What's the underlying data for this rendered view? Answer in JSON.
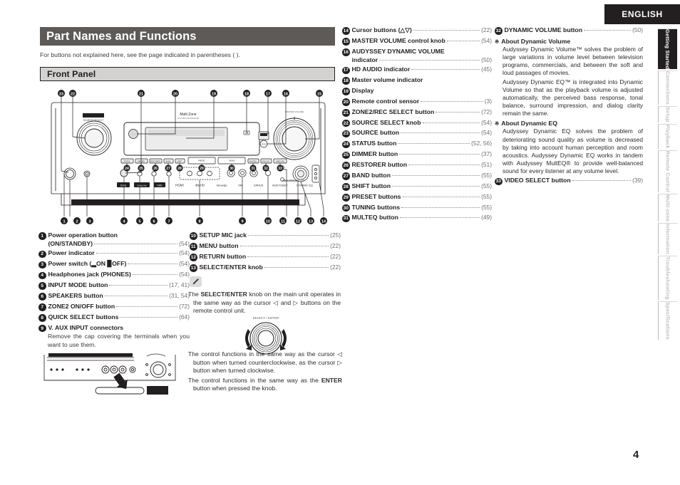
{
  "header": {
    "language_badge": "ENGLISH",
    "page_number": "4"
  },
  "title": "Part Names and Functions",
  "subtitle": "For buttons not explained here, see the page indicated in parentheses (  ).",
  "section": "Front Panel",
  "side_tabs": [
    {
      "label": "Getting Started",
      "active": true
    },
    {
      "label": "Connections",
      "active": false
    },
    {
      "label": "Setup",
      "active": false
    },
    {
      "label": "Playback",
      "active": false
    },
    {
      "label": "Remote Control",
      "active": false
    },
    {
      "label": "Multi-zone",
      "active": false
    },
    {
      "label": "Information",
      "active": false
    },
    {
      "label": "Troubleshooting",
      "active": false
    },
    {
      "label": "Specifications",
      "active": false
    }
  ],
  "column_a": [
    {
      "num": "1",
      "label": "Power operation button",
      "label2": "(ON/STANDBY)",
      "page": "(54)"
    },
    {
      "num": "2",
      "label": "Power indicator",
      "page": "(54)"
    },
    {
      "num": "3",
      "label": "Power switch (▂ON ▉OFF)",
      "page": "(54)"
    },
    {
      "num": "4",
      "label": "Headphones jack (PHONES)",
      "page": "(54)"
    },
    {
      "num": "5",
      "label": "INPUT MODE button",
      "page": "(17, 41)"
    },
    {
      "num": "6",
      "label": "SPEAKERS button",
      "page": "(31, 54)"
    },
    {
      "num": "7",
      "label": "ZONE2 ON/OFF button",
      "page": "(72)"
    },
    {
      "num": "8",
      "label": "QUICK SELECT buttons",
      "page": "(64)"
    },
    {
      "num": "9",
      "label": "V. AUX INPUT connectors",
      "note": "Remove the cap covering the terminals when you want to use them."
    }
  ],
  "column_b": [
    {
      "num": "10",
      "label": "SETUP MIC jack",
      "page": "(25)"
    },
    {
      "num": "11",
      "label": "MENU button",
      "page": "(22)"
    },
    {
      "num": "12",
      "label": "RETURN button",
      "page": "(22)"
    },
    {
      "num": "13",
      "label": "SELECT/ENTER knob",
      "page": "(22)"
    }
  ],
  "note_block": {
    "icon": "pencil-icon",
    "text_before": "The ",
    "bold": "SELECT/ENTER",
    "text_after": " knob on the main unit operates in the same way as the cursor ◁ and ▷ buttons on the remote control unit.",
    "knob_caption": "SELECT / ENTER"
  },
  "bullets2": [
    {
      "text": "The control functions in the same way as the cursor ◁ button when turned counterclockwise, as the cursor ▷ button when turned clockwise."
    },
    {
      "pre": "The control functions in the same way as the ",
      "bold": "ENTER",
      "post": " button when pressed the knob."
    }
  ],
  "column_c": [
    {
      "num": "14",
      "label": "Cursor buttons (△▽)",
      "page": "(22)"
    },
    {
      "num": "15",
      "label": "MASTER VOLUME control knob",
      "page": "(54)"
    },
    {
      "num": "16",
      "label": "AUDYSSEY DYNAMIC VOLUME",
      "label2": "indicator",
      "page": "(50)"
    },
    {
      "num": "17",
      "label": "HD AUDIO indicator",
      "page": "(45)"
    },
    {
      "num": "18",
      "label": "Master volume indicator",
      "page": ""
    },
    {
      "num": "19",
      "label": "Display",
      "page": ""
    },
    {
      "num": "20",
      "label": "Remote control sensor",
      "page": "(3)"
    },
    {
      "num": "21",
      "label": "ZONE2/REC SELECT button",
      "page": "(72)"
    },
    {
      "num": "22",
      "label": "SOURCE SELECT knob",
      "page": "(54)"
    },
    {
      "num": "23",
      "label": "SOURCE button",
      "page": "(54)"
    },
    {
      "num": "24",
      "label": "STATUS button",
      "page": "(52, 56)"
    },
    {
      "num": "25",
      "label": "DIMMER button",
      "page": "(37)"
    },
    {
      "num": "26",
      "label": "RESTORER button",
      "page": "(51)"
    },
    {
      "num": "27",
      "label": "BAND button",
      "page": "(55)"
    },
    {
      "num": "28",
      "label": "SHIFT button",
      "page": "(55)"
    },
    {
      "num": "29",
      "label": "PRESET buttons",
      "page": "(55)"
    },
    {
      "num": "30",
      "label": "TUNING buttons",
      "page": "(55)"
    },
    {
      "num": "31",
      "label": "MULTEQ button",
      "page": "(49)"
    }
  ],
  "column_d": {
    "item32": {
      "num": "32",
      "label": "DYNAMIC VOLUME button",
      "page": "(50)"
    },
    "dyn_volume_head": "About Dynamic Volume",
    "dyn_volume_p1": "Audyssey Dynamic Volume™ solves the problem of large variations in volume level between television programs, commercials, and between the soft and loud passages of movies.",
    "dyn_volume_p2": "Audyssey Dynamic EQ™ is integrated into Dynamic Volume so that as the playback volume is adjusted automatically, the perceived bass response, tonal balance, surround impression, and dialog clarity remain the same.",
    "dyn_eq_head": "About Dynamic EQ",
    "dyn_eq_p1": "Audyssey Dynamic EQ solves the problem of deteriorating sound quality as volume is decreased by taking into account human perception and room acoustics. Audyssey Dynamic EQ works in tandem with Audyssey MultEQ® to provide well-balanced sound for every listener at any volume level.",
    "item33": {
      "num": "33",
      "label": "VIDEO SELECT button",
      "page": "(39)"
    },
    "section_mark": "※"
  },
  "diagram": {
    "brand": "DENON",
    "source_select_label": "SOURCE SELECT",
    "multi_zone_label": "Multi Zone",
    "master_volume_label": "MASTER VOLUME",
    "top_callouts": [
      "23",
      "22",
      "21",
      "20",
      "19",
      "18",
      "17",
      "16",
      "15"
    ],
    "mid_callouts": [
      "24",
      "25",
      "26",
      "27",
      "28",
      "29",
      "30",
      "31",
      "32",
      "33"
    ],
    "bottom_callouts": [
      "1",
      "2",
      "3",
      "4",
      "5",
      "6",
      "7",
      "8",
      "9",
      "10",
      "11",
      "12",
      "13",
      "14"
    ],
    "panel_logos": [
      "HDMI",
      "DTS",
      "Dolby",
      "DSD"
    ]
  }
}
